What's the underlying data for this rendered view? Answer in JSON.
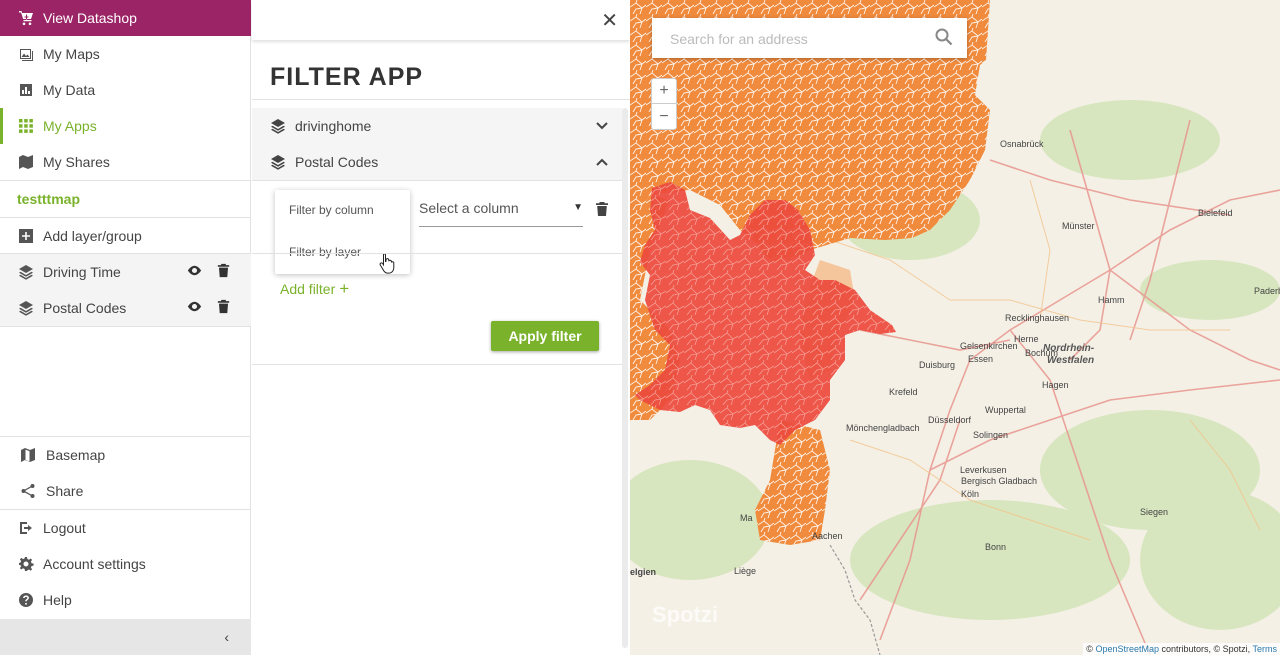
{
  "sidebar": {
    "datashop_label": "View Datashop",
    "nav": [
      {
        "label": "My Maps",
        "icon": "maps-icon"
      },
      {
        "label": "My Data",
        "icon": "chart-icon"
      },
      {
        "label": "My Apps",
        "icon": "apps-grid-icon",
        "active": true
      },
      {
        "label": "My Shares",
        "icon": "shares-icon"
      }
    ],
    "map_name": "testttmap",
    "add_layer_label": "Add layer/group",
    "layers": [
      {
        "label": "Driving Time"
      },
      {
        "label": "Postal Codes"
      }
    ],
    "bottom": [
      {
        "label": "Basemap"
      },
      {
        "label": "Share"
      },
      {
        "label": "Logout"
      },
      {
        "label": "Account settings"
      },
      {
        "label": "Help"
      }
    ],
    "collapse_glyph": "‹"
  },
  "panel": {
    "close_glyph": "✕",
    "title": "FILTER APP",
    "accordion": [
      {
        "label": "drivinghome",
        "chevron": "﹀",
        "expanded": false
      },
      {
        "label": "Postal Codes",
        "chevron": "︿",
        "expanded": true
      }
    ],
    "filter_type_options": [
      "Filter by column",
      "Filter by layer"
    ],
    "column_select_value": "Select a column",
    "column_select_arrow": "▼",
    "add_filter_label": "Add filter",
    "add_filter_plus": "+",
    "apply_label": "Apply filter"
  },
  "map": {
    "search_placeholder": "Search for an address",
    "zoom_in": "+",
    "zoom_out": "−",
    "cities": [
      {
        "name": "Osnabrück"
      },
      {
        "name": "Bielefeld"
      },
      {
        "name": "Münster"
      },
      {
        "name": "Hamm"
      },
      {
        "name": "Paderbo"
      },
      {
        "name": "Recklinghausen"
      },
      {
        "name": "Herne"
      },
      {
        "name": "Gelsenkirchen"
      },
      {
        "name": "Bochum"
      },
      {
        "name": "Essen"
      },
      {
        "name": "Duisburg"
      },
      {
        "name": "Hagen"
      },
      {
        "name": "Krefeld"
      },
      {
        "name": "Wuppertal"
      },
      {
        "name": "Düsseldorf"
      },
      {
        "name": "Mönchengladbach"
      },
      {
        "name": "Solingen"
      },
      {
        "name": "Leverkusen"
      },
      {
        "name": "Bergisch Gladbach"
      },
      {
        "name": "Köln"
      },
      {
        "name": "Siegen"
      },
      {
        "name": "Bonn"
      },
      {
        "name": "Aachen"
      },
      {
        "name": "Liège"
      },
      {
        "name": "Ma"
      },
      {
        "name": "elgien"
      }
    ],
    "region_label_1": "Nordrhein-",
    "region_label_2": "Westfalen",
    "watermark": "Spotzi",
    "attribution_prefix": "© ",
    "attribution_link": "OpenStreetMap",
    "attribution_mid": " contributors, © Spotzi, ",
    "attribution_terms": "Terms"
  },
  "colors": {
    "brand_purple": "#9b2466",
    "accent_green": "#7ab22b",
    "orange_region": "#f08a3c",
    "red_region": "#ec4a3c"
  }
}
